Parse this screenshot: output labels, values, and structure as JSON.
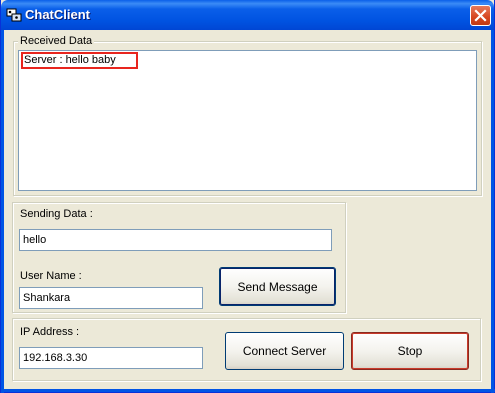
{
  "window": {
    "title": "ChatClient"
  },
  "received": {
    "legend": "Received Data",
    "messages": [
      "Server : hello baby"
    ]
  },
  "sending": {
    "legend": "Sending Data :",
    "message_value": "hello",
    "username_label": "User Name :",
    "username_value": "Shankara",
    "send_button": "Send Message"
  },
  "connection": {
    "ip_label": "IP Address :",
    "ip_value": "192.168.3.30",
    "connect_button": "Connect Server",
    "stop_button": "Stop"
  },
  "icons": {
    "app": "chat-app-icon",
    "close": "close-icon"
  },
  "colors": {
    "titlebar": "#0A5FE9",
    "highlight_border": "#E8251E",
    "face": "#ECE9D8"
  }
}
